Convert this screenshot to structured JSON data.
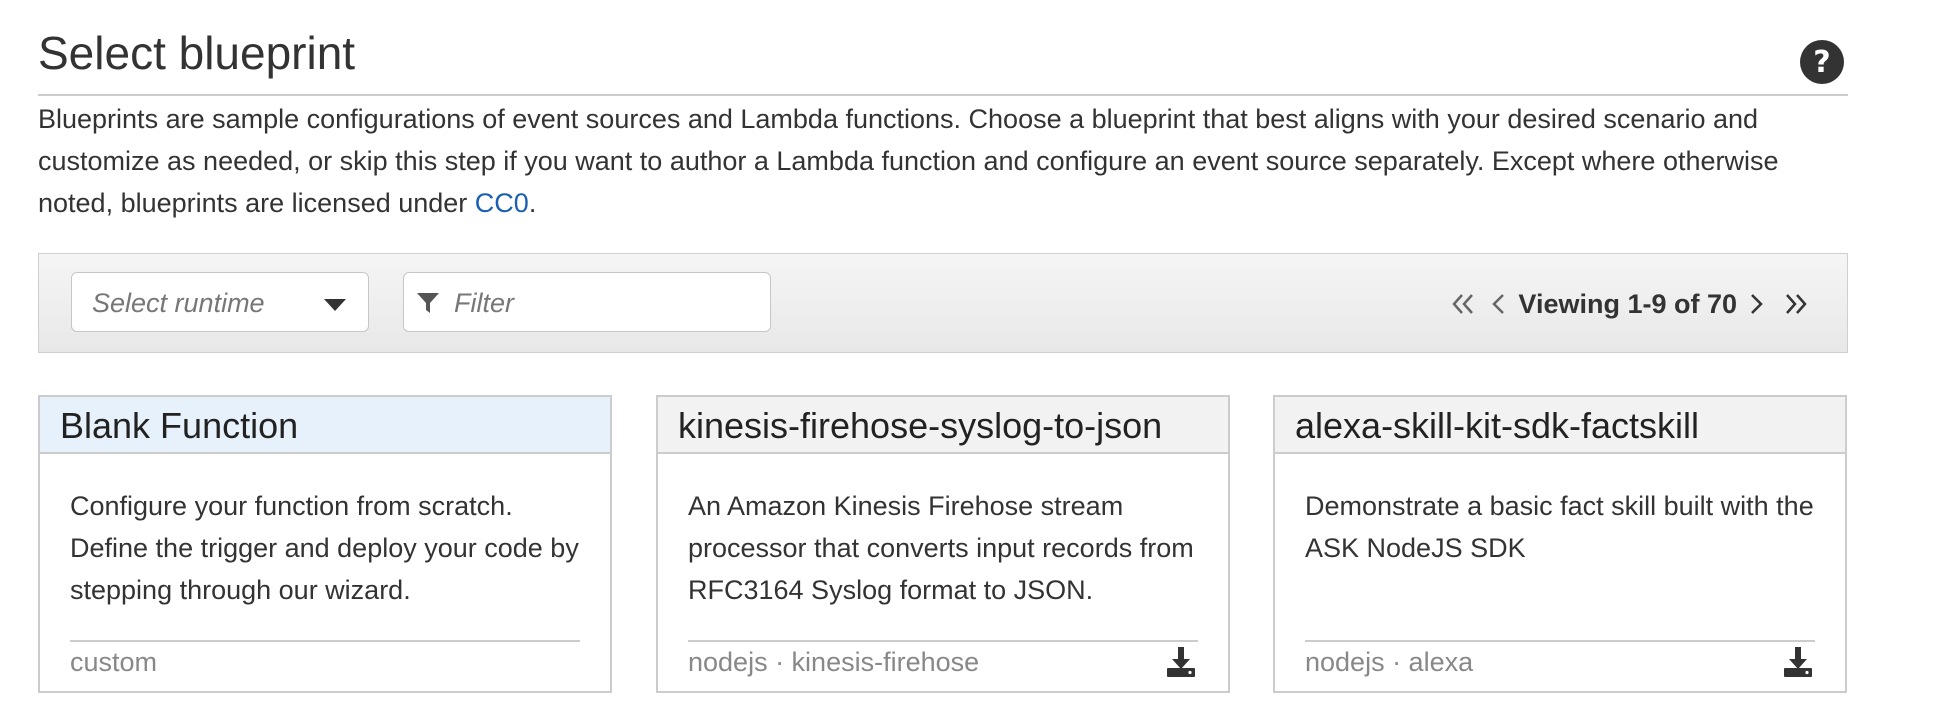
{
  "header": {
    "title": "Select blueprint",
    "help_icon": "question-circle-icon"
  },
  "description": {
    "text": "Blueprints are sample configurations of event sources and Lambda functions. Choose a blueprint that best aligns with your desired scenario and customize as needed, or skip this step if you want to author a Lambda function and configure an event source separately. Except where otherwise noted, blueprints are licensed under ",
    "link_text": "CC0",
    "suffix": "."
  },
  "toolbar": {
    "runtime_placeholder": "Select runtime",
    "filter_placeholder": "Filter",
    "pager_text": "Viewing 1-9 of 70"
  },
  "cards": [
    {
      "title": "Blank Function",
      "description": "Configure your function from scratch. Define the trigger and deploy your code by stepping through our wizard.",
      "tags": "custom",
      "selected": true
    },
    {
      "title": "kinesis-firehose-syslog-to-json",
      "description": "An Amazon Kinesis Firehose stream processor that converts input records from RFC3164 Syslog format to JSON.",
      "tags": "nodejs · kinesis-firehose",
      "download_icon": "download-icon"
    },
    {
      "title": "alexa-skill-kit-sdk-factskill",
      "description": "Demonstrate a basic fact skill built with the ASK NodeJS SDK",
      "tags": "nodejs · alexa",
      "download_icon": "download-icon"
    }
  ],
  "colors": {
    "link": "#1a5fb4",
    "selected_header": "#e6f1fb",
    "text": "#333333"
  }
}
